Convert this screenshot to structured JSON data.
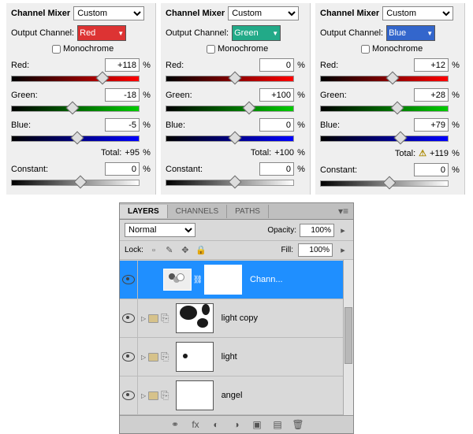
{
  "mixers": [
    {
      "title": "Channel Mixer",
      "preset": "Custom",
      "output_label": "Output Channel:",
      "output_value": "Red",
      "output_class": "red-bg",
      "mono_label": "Monochrome",
      "sliders": {
        "red": {
          "label": "Red:",
          "value": "+118",
          "thumb": 110
        },
        "green": {
          "label": "Green:",
          "value": "-18",
          "thumb": 72
        },
        "blue": {
          "label": "Blue:",
          "value": "-5",
          "thumb": 78
        }
      },
      "total_label": "Total:",
      "total_value": "+95",
      "total_warn": false,
      "constant": {
        "label": "Constant:",
        "value": "0",
        "thumb": 82
      }
    },
    {
      "title": "Channel Mixer",
      "preset": "Custom",
      "output_label": "Output Channel:",
      "output_value": "Green",
      "output_class": "green-bg",
      "mono_label": "Monochrome",
      "sliders": {
        "red": {
          "label": "Red:",
          "value": "0",
          "thumb": 82
        },
        "green": {
          "label": "Green:",
          "value": "+100",
          "thumb": 100
        },
        "blue": {
          "label": "Blue:",
          "value": "0",
          "thumb": 82
        }
      },
      "total_label": "Total:",
      "total_value": "+100",
      "total_warn": false,
      "constant": {
        "label": "Constant:",
        "value": "0",
        "thumb": 82
      }
    },
    {
      "title": "Channel Mixer",
      "preset": "Custom",
      "output_label": "Output Channel:",
      "output_value": "Blue",
      "output_class": "blue-bg",
      "mono_label": "Monochrome",
      "sliders": {
        "red": {
          "label": "Red:",
          "value": "+12",
          "thumb": 86
        },
        "green": {
          "label": "Green:",
          "value": "+28",
          "thumb": 92
        },
        "blue": {
          "label": "Blue:",
          "value": "+79",
          "thumb": 96
        }
      },
      "total_label": "Total:",
      "total_value": "+119",
      "total_warn": true,
      "constant": {
        "label": "Constant:",
        "value": "0",
        "thumb": 82
      }
    }
  ],
  "layers_panel": {
    "tabs": [
      "LAYERS",
      "CHANNELS",
      "PATHS"
    ],
    "active_tab": 0,
    "blend": "Normal",
    "opacity_label": "Opacity:",
    "opacity": "100%",
    "lock_label": "Lock:",
    "fill_label": "Fill:",
    "fill": "100%",
    "layers": [
      {
        "name": "Chann...",
        "selected": true,
        "type": "adjustment"
      },
      {
        "name": "light copy",
        "selected": false,
        "type": "image",
        "preview": "blobs"
      },
      {
        "name": "light",
        "selected": false,
        "type": "image",
        "preview": "dot"
      },
      {
        "name": "angel",
        "selected": false,
        "type": "image",
        "preview": "blank"
      }
    ]
  }
}
